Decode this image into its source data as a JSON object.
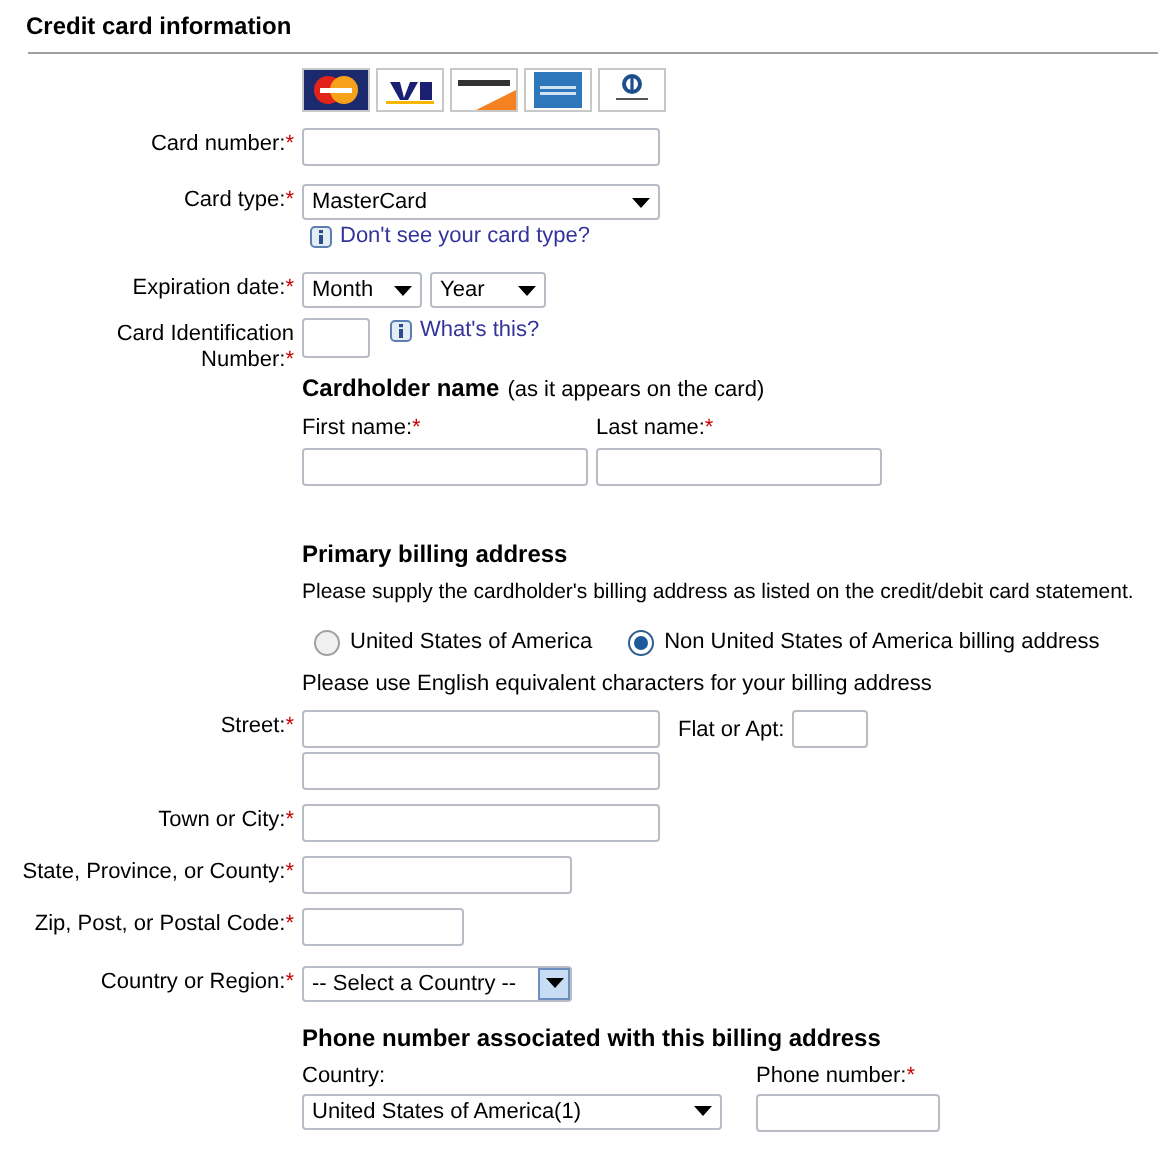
{
  "title": "Credit card information",
  "card_logos": [
    {
      "kind": "mastercard"
    },
    {
      "kind": "visa"
    },
    {
      "kind": "discover"
    },
    {
      "kind": "amex"
    },
    {
      "kind": "diners"
    }
  ],
  "card_number": {
    "label": "Card number:",
    "mark": "*"
  },
  "card_type": {
    "label": "Card type:",
    "mark": "*",
    "value": "MasterCard",
    "help_link": "Don't see your card type?"
  },
  "expiration": {
    "label": "Expiration date:",
    "mark": "*",
    "month": "Month",
    "year": "Year"
  },
  "cin": {
    "label": "Card Identification Number:",
    "mark": "*",
    "help_link": "What's this?"
  },
  "cardholder": {
    "heading": "Cardholder name",
    "note": "(as it appears on the card)",
    "first_name": {
      "label": "First name:",
      "mark": "*"
    },
    "last_name": {
      "label": "Last name:",
      "mark": "*"
    }
  },
  "billing": {
    "heading": "Primary billing address",
    "instruction": "Please supply the cardholder's billing address as listed on the credit/debit card statement.",
    "options": [
      {
        "label": "United States of America",
        "selected": false
      },
      {
        "label": "Non United States of America billing address",
        "selected": true
      }
    ],
    "note": "Please use English equivalent characters for your billing address",
    "street": {
      "label": "Street:",
      "mark": "*"
    },
    "flat": {
      "label": "Flat or Apt:"
    },
    "town": {
      "label": "Town or City:",
      "mark": "*"
    },
    "state": {
      "label": "State, Province, or County:",
      "mark": "*"
    },
    "zip": {
      "label": "Zip, Post, or Postal Code:",
      "mark": "*"
    },
    "country": {
      "label": "Country or Region:",
      "mark": "*",
      "value": "-- Select a Country --"
    }
  },
  "phone": {
    "heading": "Phone number associated with this billing address",
    "country": {
      "label": "Country:",
      "value": "United States of America(1)"
    },
    "number": {
      "label": "Phone number:",
      "mark": "*"
    }
  }
}
